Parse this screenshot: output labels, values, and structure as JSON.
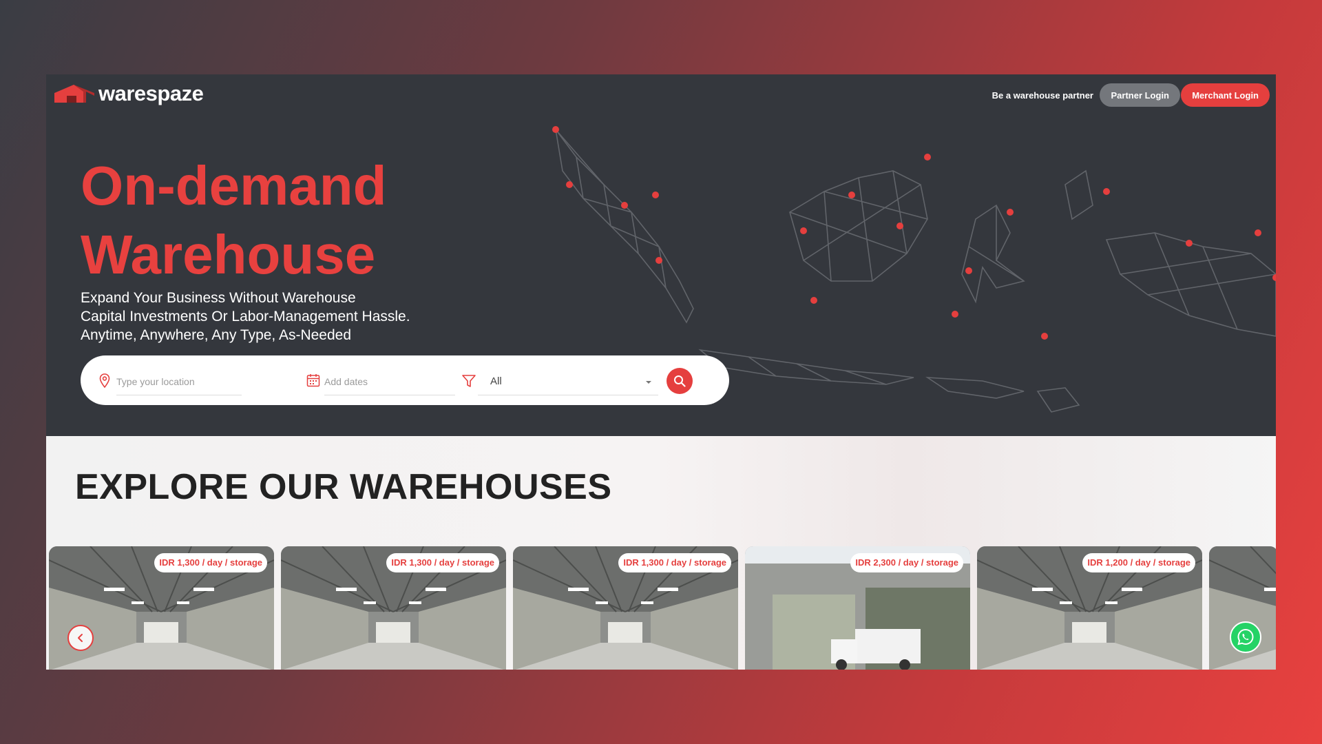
{
  "brand": {
    "name": "warespaze",
    "accent": "#e53f3e",
    "dark": "#34373d"
  },
  "nav": {
    "partner_link": "Be a warehouse partner",
    "partner_login": "Partner Login",
    "merchant_login": "Merchant Login"
  },
  "hero": {
    "title_line1": "On-demand",
    "title_line2": "Warehouse",
    "subtitle_line1": "Expand Your Business Without Warehouse",
    "subtitle_line2": "Capital Investments Or Labor-Management Hassle.",
    "subtitle_line3": "Anytime, Anywhere, Any Type, As-Needed"
  },
  "search": {
    "location_placeholder": "Type your location",
    "dates_placeholder": "Add dates",
    "type_value": "All",
    "location_icon": "map-pin-icon",
    "dates_icon": "calendar-icon",
    "filter_icon": "filter-icon",
    "search_icon": "search-icon"
  },
  "section": {
    "title": "EXPLORE OUR WAREHOUSES"
  },
  "warehouses": [
    {
      "price": "IDR 1,300 / day / storage"
    },
    {
      "price": "IDR 1,300 / day / storage"
    },
    {
      "price": "IDR 1,300 / day / storage"
    },
    {
      "price": "IDR 2,300 / day / storage"
    },
    {
      "price": "IDR 1,200 / day / storage"
    },
    {
      "price": ""
    }
  ],
  "controls": {
    "prev_icon": "chevron-left-icon",
    "chat_icon": "whatsapp-icon"
  }
}
